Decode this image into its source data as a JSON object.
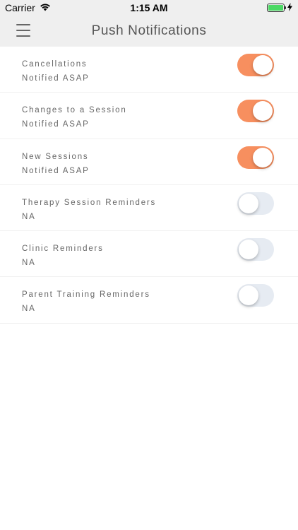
{
  "status_bar": {
    "carrier": "Carrier",
    "time": "1:15 AM",
    "wifi_icon": "wifi-icon",
    "battery_icon": "battery-icon",
    "charging_icon": "bolt-icon"
  },
  "nav": {
    "title": "Push Notifications",
    "menu_icon": "hamburger-menu-icon"
  },
  "colors": {
    "toggle_on": "#f78f5f",
    "toggle_off": "#e6ebf2",
    "nav_bg": "#efefef"
  },
  "rows": [
    {
      "title": "Cancellations",
      "subtitle": "Notified ASAP",
      "enabled": true
    },
    {
      "title": "Changes to a Session",
      "subtitle": "Notified ASAP",
      "enabled": true
    },
    {
      "title": "New Sessions",
      "subtitle": "Notified ASAP",
      "enabled": true
    },
    {
      "title": "Therapy Session Reminders",
      "subtitle": "NA",
      "enabled": false
    },
    {
      "title": "Clinic Reminders",
      "subtitle": "NA",
      "enabled": false
    },
    {
      "title": "Parent Training Reminders",
      "subtitle": "NA",
      "enabled": false
    }
  ]
}
